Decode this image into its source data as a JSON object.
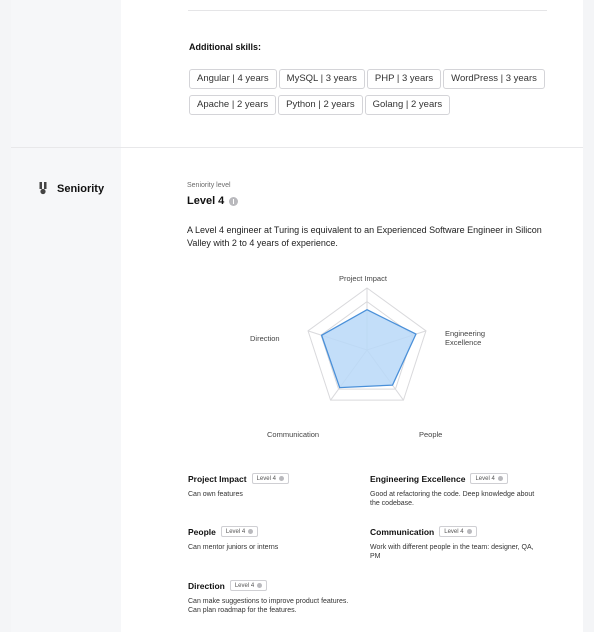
{
  "additional_skills": {
    "title": "Additional skills:",
    "chips": [
      "Angular | 4 years",
      "MySQL | 3 years",
      "PHP | 3 years",
      "WordPress | 3 years",
      "Apache | 2 years",
      "Python | 2 years",
      "Golang | 2 years"
    ]
  },
  "seniority": {
    "section_title": "Seniority",
    "section_icon": "badge-icon",
    "level_label": "Seniority level",
    "level_value": "Level 4",
    "description": "A Level 4 engineer at Turing is equivalent to an Experienced Software Engineer in Silicon Valley with 2 to 4 years of experience.",
    "radar": {
      "axes": {
        "project_impact": "Project Impact",
        "engineering_excellence_1": "Engineering",
        "engineering_excellence_2": "Excellence",
        "people": "People",
        "communication": "Communication",
        "direction": "Direction"
      },
      "fill_color": "#b8d8f8",
      "stroke_color": "#4a90d9",
      "grid_color": "#d9d9dc"
    },
    "dimensions": [
      {
        "title": "Project Impact",
        "level": "Level 4",
        "desc": "Can own features"
      },
      {
        "title": "Engineering Excellence",
        "level": "Level 4",
        "desc": "Good at refactoring the code. Deep knowledge about the codebase."
      },
      {
        "title": "People",
        "level": "Level 4",
        "desc": "Can mentor juniors or interns"
      },
      {
        "title": "Communication",
        "level": "Level 4",
        "desc": "Work with different people in the team: designer, QA, PM"
      },
      {
        "title": "Direction",
        "level": "Level 4",
        "desc": "Can make suggestions to improve product features. Can plan roadmap for the features."
      }
    ]
  }
}
